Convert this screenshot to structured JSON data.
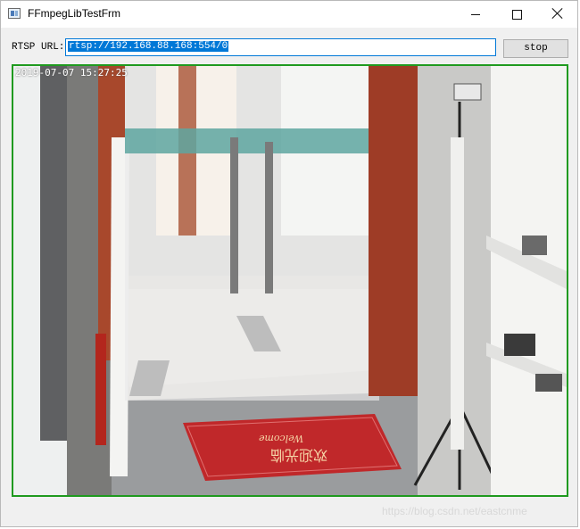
{
  "window": {
    "title": "FFmpegLibTestFrm"
  },
  "toolbar": {
    "rtsp_label": "RTSP URL:",
    "url_value": "rtsp://192.168.88.168:554/0",
    "stop_label": "stop"
  },
  "video": {
    "timestamp": "2019-07-07 15:27:25",
    "mat_text": "欢迎光临",
    "mat_script": "Welcome"
  },
  "watermark": "https://blog.csdn.net/eastcnme",
  "colors": {
    "frame_border": "#1f9a1f",
    "input_border": "#0078d7",
    "selection": "#0078d7",
    "mat": "#c0282a"
  },
  "icons": {
    "app": "app-window-icon",
    "minimize": "minimize-icon",
    "maximize": "maximize-icon",
    "close": "close-icon"
  }
}
